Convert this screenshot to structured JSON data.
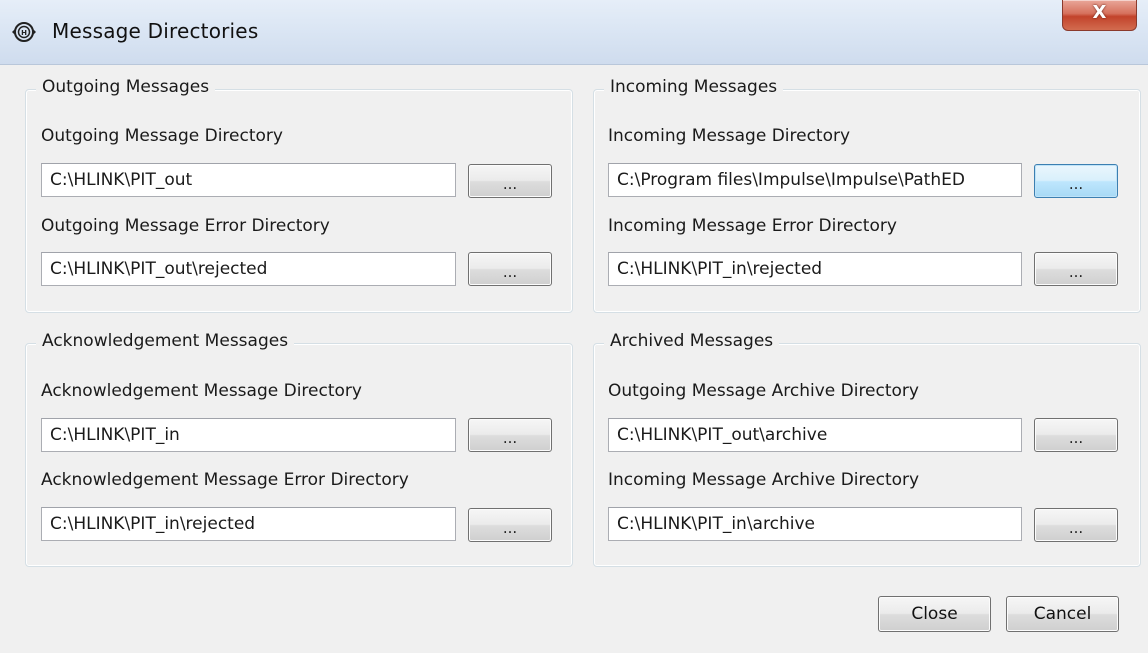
{
  "window": {
    "title": "Message Directories",
    "close_glyph": "X"
  },
  "groups": {
    "outgoing": {
      "legend": "Outgoing Messages",
      "fields": [
        {
          "label": "Outgoing Message Directory",
          "value": "C:\\HLINK\\PIT_out"
        },
        {
          "label": "Outgoing Message Error Directory",
          "value": "C:\\HLINK\\PIT_out\\rejected"
        }
      ]
    },
    "incoming": {
      "legend": "Incoming Messages",
      "fields": [
        {
          "label": "Incoming Message Directory",
          "value": "C:\\Program files\\Impulse\\Impulse\\PathED"
        },
        {
          "label": "Incoming Message Error Directory",
          "value": "C:\\HLINK\\PIT_in\\rejected"
        }
      ]
    },
    "ack": {
      "legend": "Acknowledgement Messages",
      "fields": [
        {
          "label": "Acknowledgement Message Directory",
          "value": "C:\\HLINK\\PIT_in"
        },
        {
          "label": "Acknowledgement Message Error Directory",
          "value": "C:\\HLINK\\PIT_in\\rejected"
        }
      ]
    },
    "archived": {
      "legend": "Archived Messages",
      "fields": [
        {
          "label": "Outgoing Message Archive Directory",
          "value": "C:\\HLINK\\PIT_out\\archive"
        },
        {
          "label": "Incoming Message Archive Directory",
          "value": "C:\\HLINK\\PIT_in\\archive"
        }
      ]
    }
  },
  "browse_label": "...",
  "buttons": {
    "close": "Close",
    "cancel": "Cancel"
  },
  "icons": {
    "app": "hl7-app-icon",
    "close": "close-icon"
  }
}
